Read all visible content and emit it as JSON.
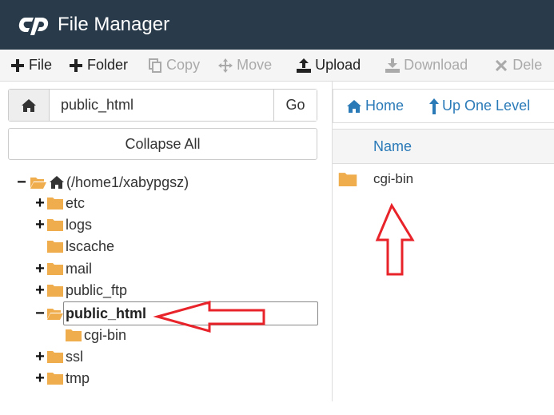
{
  "header": {
    "title": "File Manager"
  },
  "toolbar": {
    "file": "File",
    "folder": "Folder",
    "copy": "Copy",
    "move": "Move",
    "upload": "Upload",
    "download": "Download",
    "delete": "Dele"
  },
  "path_bar": {
    "value": "public_html",
    "go_label": "Go"
  },
  "collapse_label": "Collapse All",
  "tree": {
    "root": "(/home1/xabypgsz)",
    "items": [
      "etc",
      "logs",
      "lscache",
      "mail",
      "public_ftp",
      "public_html",
      "cgi-bin",
      "ssl",
      "tmp"
    ]
  },
  "right": {
    "home_label": "Home",
    "up_label": "Up One Level",
    "column_name": "Name",
    "files": [
      "cgi-bin"
    ]
  },
  "colors": {
    "header_bg": "#293a4a",
    "folder": "#f0ad4e",
    "link": "#2a7ab8",
    "arrow": "#e8232a"
  }
}
